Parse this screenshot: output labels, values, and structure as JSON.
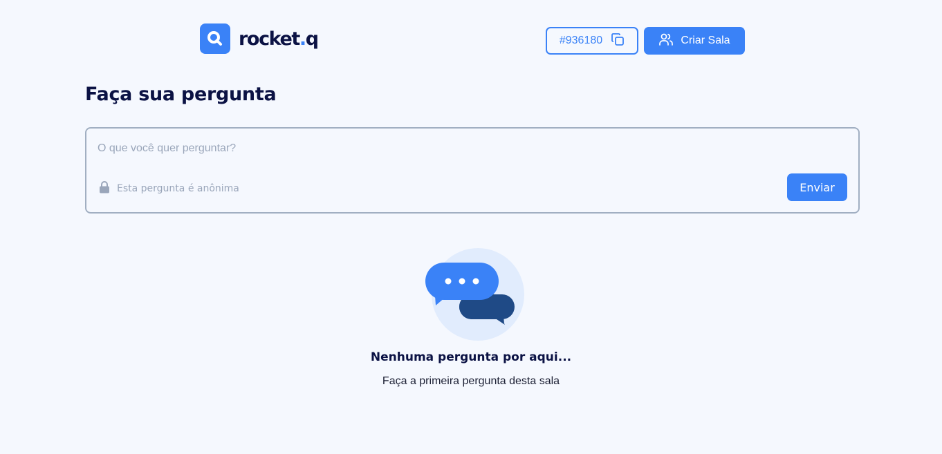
{
  "header": {
    "logo_text": "rocket",
    "logo_dot": ".",
    "logo_suffix": "q",
    "room_code": "#936180",
    "create_room_label": "Criar Sala"
  },
  "main": {
    "title": "Faça sua pergunta",
    "question_placeholder": "O que você quer perguntar?",
    "anonymous_label": "Esta pergunta é anônima",
    "send_label": "Enviar"
  },
  "empty_state": {
    "title": "Nenhuma pergunta por aqui...",
    "subtitle": "Faça a primeira pergunta desta sala"
  },
  "icons": {
    "logo": "magnifier-logo-icon",
    "copy": "copy-icon",
    "users": "users-icon",
    "lock": "lock-icon",
    "chat": "chat-bubbles-icon"
  },
  "colors": {
    "accent": "#3A82F7",
    "dark_text": "#0B1244",
    "background": "#F5F8FE",
    "muted": "#9AA6BA"
  }
}
